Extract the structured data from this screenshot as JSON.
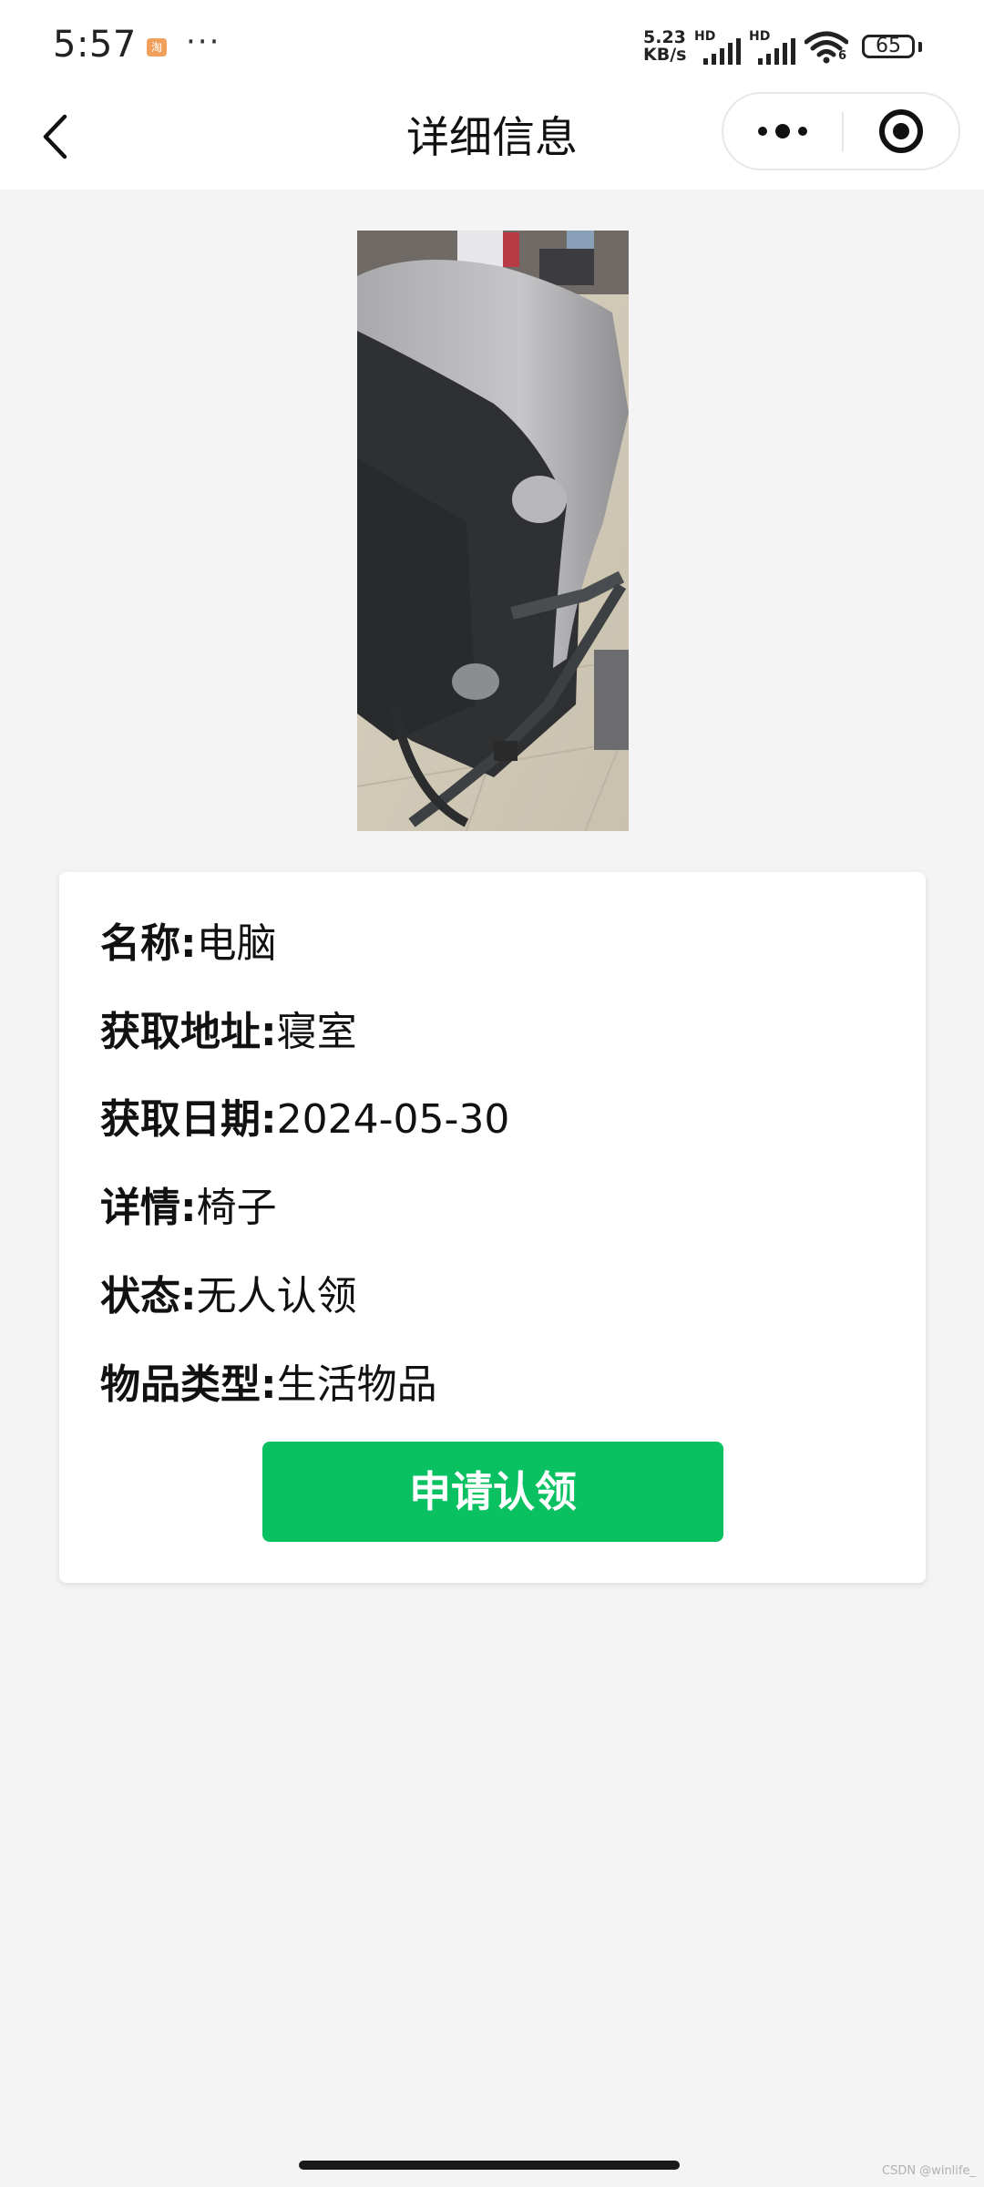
{
  "status_bar": {
    "time": "5:57",
    "more_dots": "···",
    "net_speed_value": "5.23",
    "net_speed_unit": "KB/s",
    "sim1_label": "HD",
    "sim2_label": "HD",
    "wifi_badge": "6",
    "battery": "65"
  },
  "nav": {
    "title": "详细信息"
  },
  "item": {
    "fields": [
      {
        "key": "名称:",
        "value": "电脑"
      },
      {
        "key": "获取地址:",
        "value": "寝室"
      },
      {
        "key": "获取日期:",
        "value": "2024-05-30"
      },
      {
        "key": "详情:",
        "value": "椅子"
      },
      {
        "key": "状态:",
        "value": "无人认领"
      },
      {
        "key": "物品类型:",
        "value": "生活物品"
      }
    ],
    "claim_button": "申请认领"
  },
  "watermark": "CSDN @winlife_",
  "colors": {
    "accent": "#09c160",
    "background": "#f4f4f4"
  }
}
